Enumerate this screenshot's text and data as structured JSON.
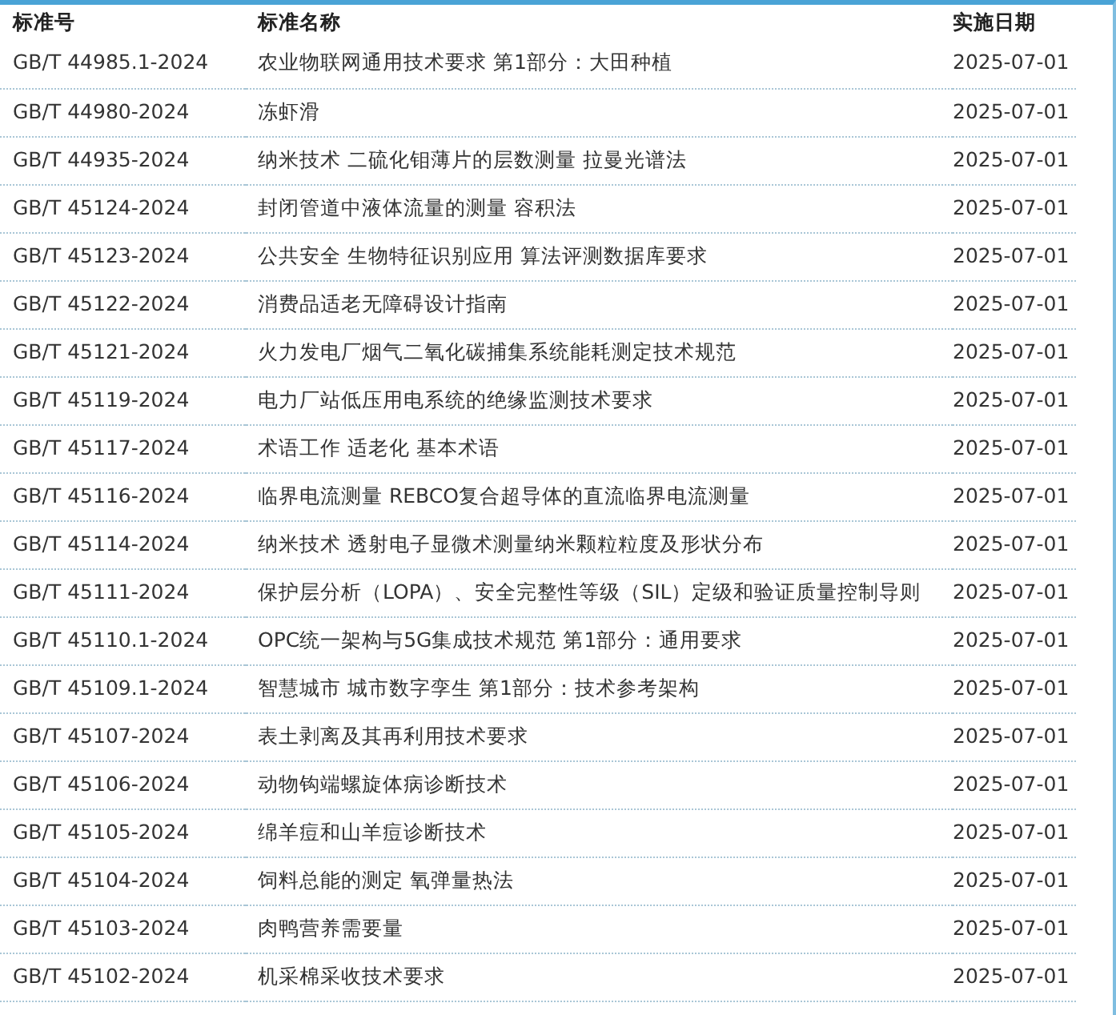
{
  "table": {
    "columns": [
      "标准号",
      "标准名称",
      "实施日期"
    ],
    "rows": [
      [
        "GB/T 44985.1-2024",
        "农业物联网通用技术要求 第1部分：大田种植",
        "2025-07-01"
      ],
      [
        "GB/T 44980-2024",
        "冻虾滑",
        "2025-07-01"
      ],
      [
        "GB/T 44935-2024",
        "纳米技术 二硫化钼薄片的层数测量 拉曼光谱法",
        "2025-07-01"
      ],
      [
        "GB/T 45124-2024",
        "封闭管道中液体流量的测量 容积法",
        "2025-07-01"
      ],
      [
        "GB/T 45123-2024",
        "公共安全 生物特征识别应用 算法评测数据库要求",
        "2025-07-01"
      ],
      [
        "GB/T 45122-2024",
        "消费品适老无障碍设计指南",
        "2025-07-01"
      ],
      [
        "GB/T 45121-2024",
        "火力发电厂烟气二氧化碳捕集系统能耗测定技术规范",
        "2025-07-01"
      ],
      [
        "GB/T 45119-2024",
        "电力厂站低压用电系统的绝缘监测技术要求",
        "2025-07-01"
      ],
      [
        "GB/T 45117-2024",
        "术语工作 适老化 基本术语",
        "2025-07-01"
      ],
      [
        "GB/T 45116-2024",
        "临界电流测量 REBCO复合超导体的直流临界电流测量",
        "2025-07-01"
      ],
      [
        "GB/T 45114-2024",
        "纳米技术 透射电子显微术测量纳米颗粒粒度及形状分布",
        "2025-07-01"
      ],
      [
        "GB/T 45111-2024",
        "保护层分析（LOPA）、安全完整性等级（SIL）定级和验证质量控制导则",
        "2025-07-01"
      ],
      [
        "GB/T 45110.1-2024",
        "OPC统一架构与5G集成技术规范 第1部分：通用要求",
        "2025-07-01"
      ],
      [
        "GB/T 45109.1-2024",
        "智慧城市 城市数字孪生 第1部分：技术参考架构",
        "2025-07-01"
      ],
      [
        "GB/T 45107-2024",
        "表土剥离及其再利用技术要求",
        "2025-07-01"
      ],
      [
        "GB/T 45106-2024",
        "动物钩端螺旋体病诊断技术",
        "2025-07-01"
      ],
      [
        "GB/T 45105-2024",
        "绵羊痘和山羊痘诊断技术",
        "2025-07-01"
      ],
      [
        "GB/T 45104-2024",
        "饲料总能的测定 氧弹量热法",
        "2025-07-01"
      ],
      [
        "GB/T 45103-2024",
        "肉鸭营养需要量",
        "2025-07-01"
      ],
      [
        "GB/T 45102-2024",
        "机采棉采收技术要求",
        "2025-07-01"
      ]
    ]
  }
}
